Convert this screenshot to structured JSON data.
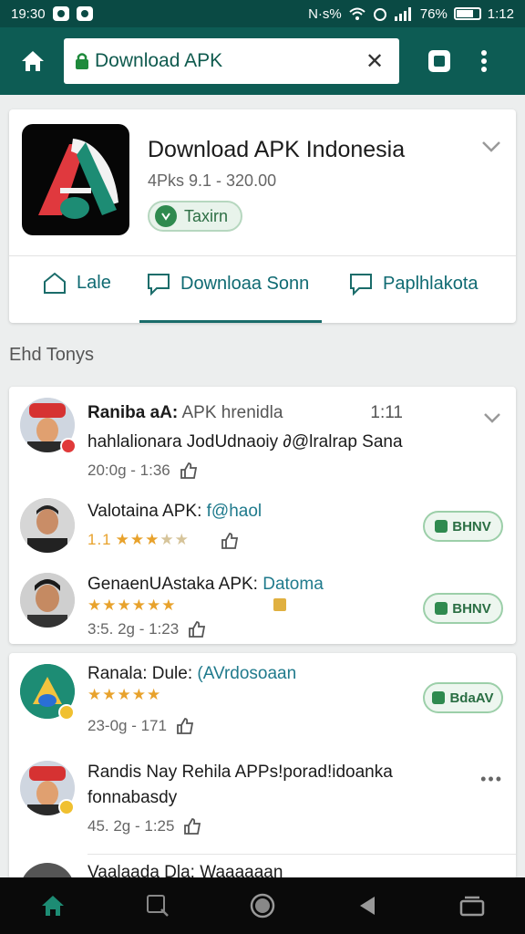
{
  "status_bar": {
    "time": "19:30",
    "right_text": "N·s%",
    "battery": "76%",
    "clock": "1:12"
  },
  "browser": {
    "url_text": "Download APK",
    "clear_glyph": "✕"
  },
  "app": {
    "title": "Download APK Indonesia",
    "meta": "4Pks 9.1 - 320.00",
    "pill_label": "Taxirn",
    "icon_colors": {
      "bg": "#060606",
      "red": "#e0393e",
      "green": "#1d8c74",
      "white": "#f2f2f2"
    },
    "tabs": [
      {
        "label": "Lale"
      },
      {
        "label": "Downloaa Sonn"
      },
      {
        "label": "Paplhlakota"
      }
    ]
  },
  "section_title": "Ehd Tonys",
  "feed": [
    {
      "title_main": "Raniba aA:",
      "title_muted": " APK hrenidla",
      "title_extra": "1:11",
      "line2": "hahlalionara JodUdnaoiy ∂@lralrap Sana",
      "meta": "20:0g - 1:36"
    },
    {
      "title_main": "Valotaina APK:",
      "title_accent": " f@haol",
      "rating_num": "1.1",
      "stars_on": "★★★",
      "stars_off": "★★",
      "button": "BHNV"
    },
    {
      "title_main": "GenaenUAstaka APK:",
      "title_accent": " Datoma",
      "stars_on": "★★★★★★",
      "meta": "3:5. 2g - 1:23",
      "button": "BHNV"
    },
    {
      "title_main": "Ranala: Dule:",
      "title_accent": " (AVrdosoaan",
      "stars_on": "★★★★★",
      "meta": "23-0g - 171",
      "button": "BdaAV"
    },
    {
      "title_main": "Randis Nay Rehila APPs!porad!idoanka",
      "line2": "fonnabasdy",
      "meta": "45. 2g - 1:25"
    }
  ],
  "peek_text": "Vaalaada Dla: Waaaaaan"
}
